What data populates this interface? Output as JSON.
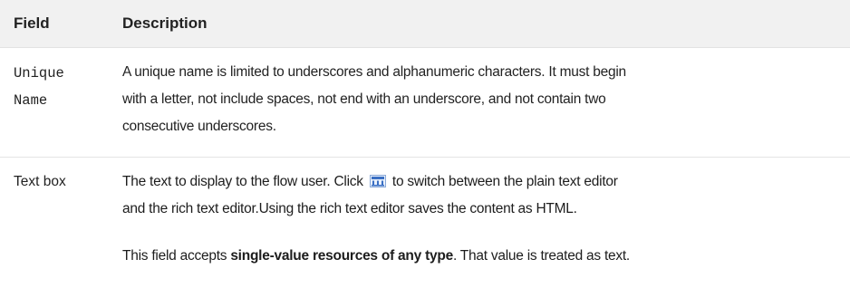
{
  "header": {
    "field": "Field",
    "description": "Description"
  },
  "rows": [
    {
      "field_line1": "Unique",
      "field_line2": "Name",
      "desc_lines": [
        "A unique name is limited to underscores and alphanumeric characters. It must begin",
        "with a letter, not include spaces, not end with an underscore, and not contain two",
        "consecutive underscores."
      ]
    },
    {
      "field": "Text box",
      "desc_line1_before_icon": "The text to display to the flow user. Click",
      "desc_line1_after_icon": "to switch between the plain text editor",
      "desc_line2": "and the rich text editor.Using the rich text editor saves the content as HTML.",
      "desc_p2_before": "This field accepts ",
      "desc_p2_bold": "single-value resources of any type",
      "desc_p2_after": ". That value is treated as text."
    }
  ],
  "icons": {
    "rich_text_toggle": "rich-text-editor-icon",
    "accent": "#3a6fc4"
  }
}
